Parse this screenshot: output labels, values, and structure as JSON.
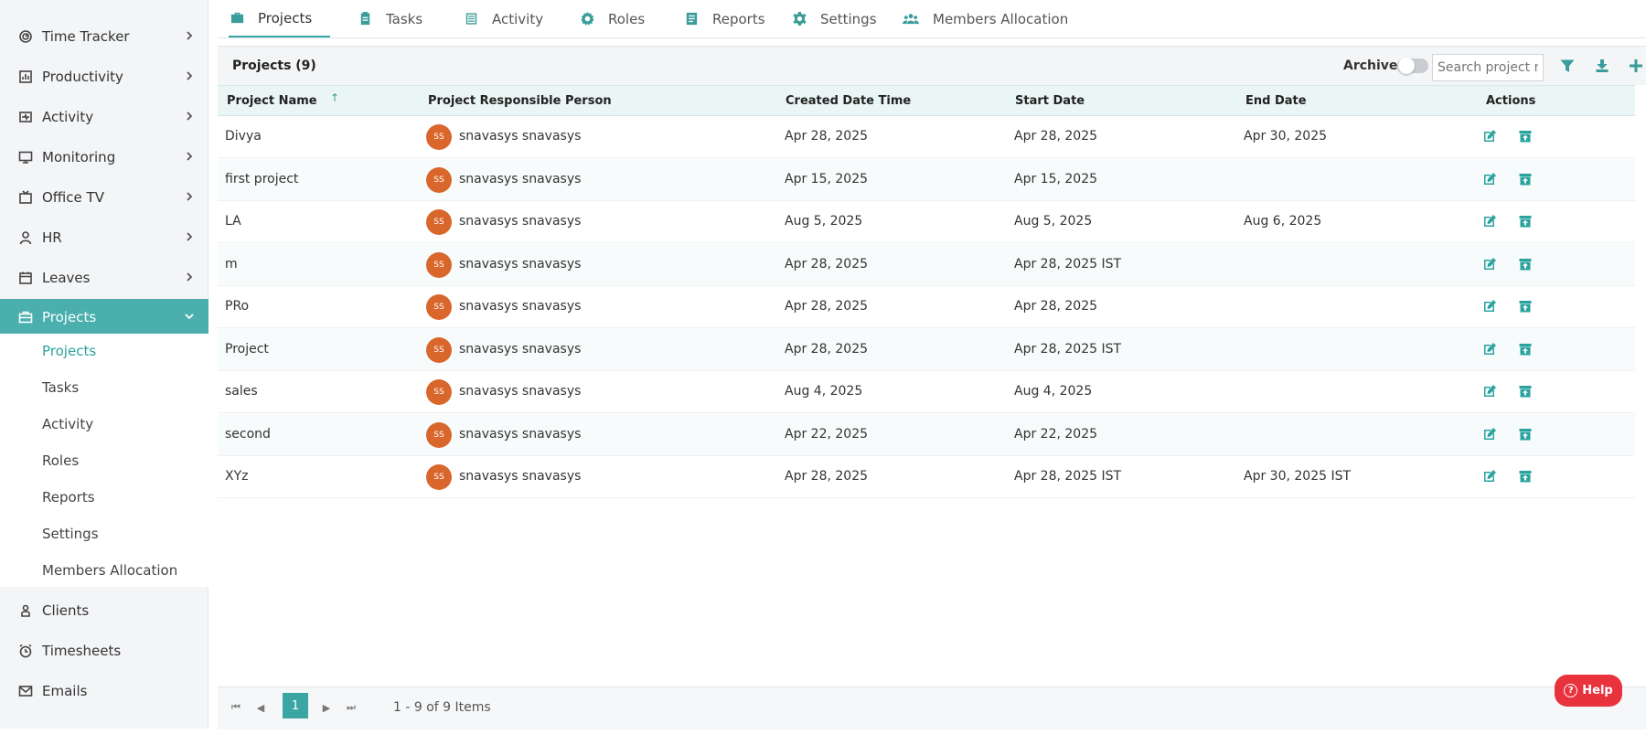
{
  "sidebar": {
    "items": [
      {
        "label": "Time Tracker",
        "icon": "clock-target-icon"
      },
      {
        "label": "Productivity",
        "icon": "chart-icon"
      },
      {
        "label": "Activity",
        "icon": "activity-icon"
      },
      {
        "label": "Monitoring",
        "icon": "monitor-icon"
      },
      {
        "label": "Office TV",
        "icon": "tv-icon"
      },
      {
        "label": "HR",
        "icon": "person-icon"
      },
      {
        "label": "Leaves",
        "icon": "calendar-icon"
      },
      {
        "label": "Projects",
        "icon": "briefcase-icon"
      },
      {
        "label": "Clients",
        "icon": "client-icon"
      },
      {
        "label": "Timesheets",
        "icon": "alarm-icon"
      },
      {
        "label": "Emails",
        "icon": "mail-icon"
      }
    ],
    "sub_items": [
      "Projects",
      "Tasks",
      "Activity",
      "Roles",
      "Reports",
      "Settings",
      "Members Allocation"
    ]
  },
  "tabs": [
    {
      "label": "Projects",
      "icon": "briefcase-icon"
    },
    {
      "label": "Tasks",
      "icon": "clipboard-icon"
    },
    {
      "label": "Activity",
      "icon": "list-icon"
    },
    {
      "label": "Roles",
      "icon": "gear-badge-icon"
    },
    {
      "label": "Reports",
      "icon": "report-icon"
    },
    {
      "label": "Settings",
      "icon": "settings-icon"
    },
    {
      "label": "Members Allocation",
      "icon": "users-icon"
    }
  ],
  "grid": {
    "title": "Projects (9)",
    "archive_label": "Archive",
    "search_placeholder": "Search project n...",
    "columns": [
      "Project Name",
      "Project Responsible Person",
      "Created Date Time",
      "Start Date",
      "End Date",
      "Actions"
    ],
    "sort_indicator": "↑",
    "rows": [
      {
        "name": "Divya",
        "initials": "SS",
        "person": "snavasys snavasys",
        "created": "Apr 28, 2025",
        "start": "Apr 28, 2025",
        "end": "Apr 30, 2025"
      },
      {
        "name": "first project",
        "initials": "SS",
        "person": "snavasys snavasys",
        "created": "Apr 15, 2025",
        "start": "Apr 15, 2025",
        "end": ""
      },
      {
        "name": "LA",
        "initials": "SS",
        "person": "snavasys snavasys",
        "created": "Aug 5, 2025",
        "start": "Aug 5, 2025",
        "end": "Aug 6, 2025"
      },
      {
        "name": "m",
        "initials": "SS",
        "person": "snavasys snavasys",
        "created": "Apr 28, 2025",
        "start": "Apr 28, 2025 IST",
        "end": ""
      },
      {
        "name": "PRo",
        "initials": "SS",
        "person": "snavasys snavasys",
        "created": "Apr 28, 2025",
        "start": "Apr 28, 2025",
        "end": ""
      },
      {
        "name": "Project",
        "initials": "SS",
        "person": "snavasys snavasys",
        "created": "Apr 28, 2025",
        "start": "Apr 28, 2025 IST",
        "end": ""
      },
      {
        "name": "sales",
        "initials": "SS",
        "person": "snavasys snavasys",
        "created": "Aug 4, 2025",
        "start": "Aug 4, 2025",
        "end": ""
      },
      {
        "name": "second",
        "initials": "SS",
        "person": "snavasys snavasys",
        "created": "Apr 22, 2025",
        "start": "Apr 22, 2025",
        "end": ""
      },
      {
        "name": "XYz",
        "initials": "SS",
        "person": "snavasys snavasys",
        "created": "Apr 28, 2025",
        "start": "Apr 28, 2025 IST",
        "end": "Apr 30, 2025 IST"
      }
    ]
  },
  "pager": {
    "current_page": "1",
    "info": "1 - 9 of 9 Items"
  },
  "help": {
    "label": "Help"
  },
  "colors": {
    "accent": "#3aa6a3",
    "avatar": "#d9672c",
    "help": "#e8323c"
  }
}
